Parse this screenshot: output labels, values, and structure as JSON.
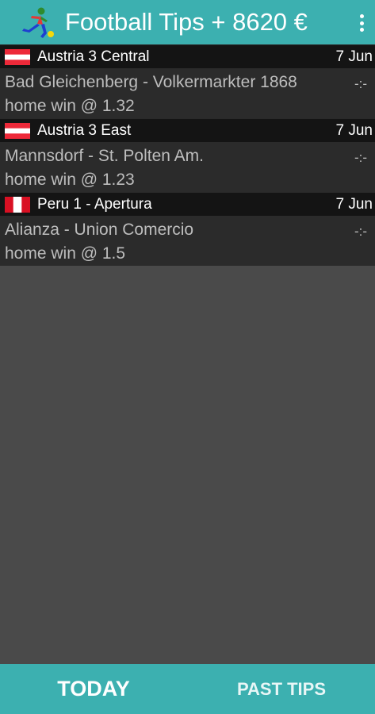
{
  "header": {
    "title": "Football Tips + 8620 €",
    "logo_icon": "football-player-icon",
    "menu_icon": "more-vert-icon"
  },
  "colors": {
    "accent": "#3cb0b0",
    "background": "#4a4a4a",
    "league_bg": "#141414",
    "match_bg": "#2b2b2b",
    "text_primary": "#ffffff",
    "text_secondary": "#bdbdbd"
  },
  "tips": [
    {
      "league": "Austria 3 Central",
      "date": "7 Jun",
      "flag": "austria-flag-icon",
      "teams": "Bad Gleichenberg - Volkermarkter 1868",
      "score": "-:-",
      "tip": "home win @ 1.32"
    },
    {
      "league": "Austria 3 East",
      "date": "7 Jun",
      "flag": "austria-flag-icon",
      "teams": "Mannsdorf - St. Polten Am.",
      "score": "-:-",
      "tip": "home win @ 1.23"
    },
    {
      "league": "Peru 1 - Apertura",
      "date": "7 Jun",
      "flag": "peru-flag-icon",
      "teams": "Alianza - Union Comercio",
      "score": "-:-",
      "tip": "home win @ 1.5"
    }
  ],
  "tabs": {
    "today": "TODAY",
    "past": "PAST TIPS"
  }
}
